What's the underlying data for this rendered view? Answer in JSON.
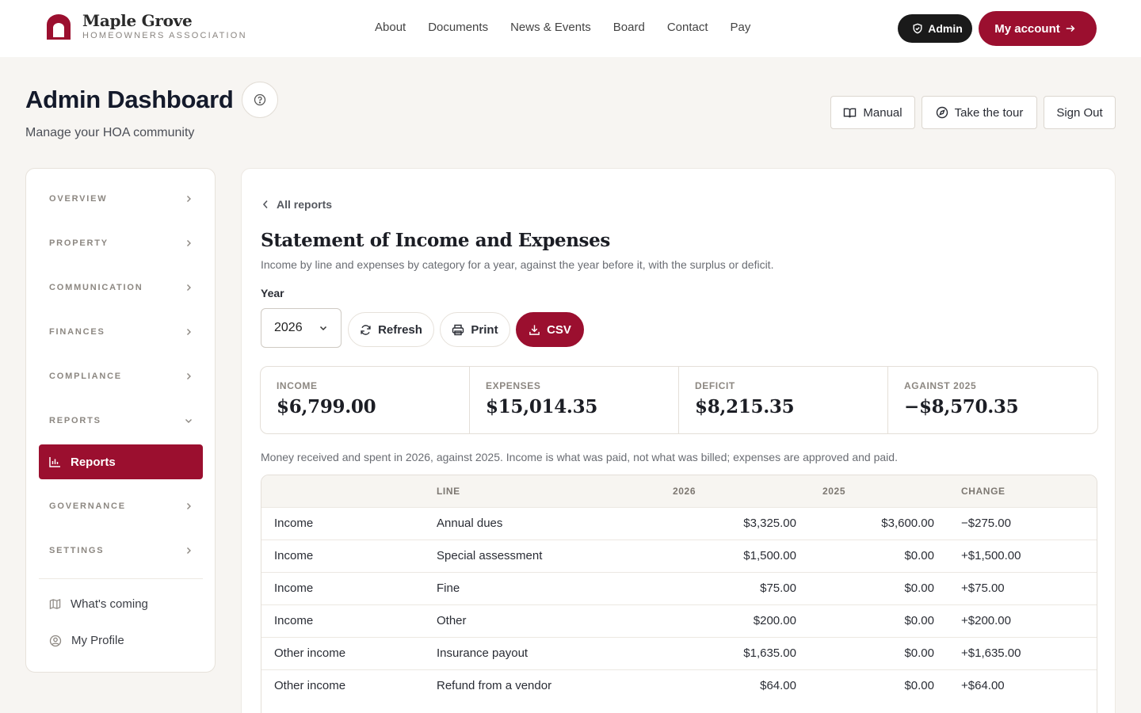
{
  "brand": {
    "name": "Maple Grove",
    "subtitle": "HOMEOWNERS ASSOCIATION"
  },
  "nav": [
    "About",
    "Documents",
    "News & Events",
    "Board",
    "Contact",
    "Pay"
  ],
  "header_actions": {
    "admin": "Admin",
    "account": "My account"
  },
  "page": {
    "title": "Admin Dashboard",
    "subtitle": "Manage your HOA community"
  },
  "page_actions": {
    "manual": "Manual",
    "tour": "Take the tour",
    "signout": "Sign Out"
  },
  "sidebar": {
    "sections": [
      "OVERVIEW",
      "PROPERTY",
      "COMMUNICATION",
      "FINANCES",
      "COMPLIANCE",
      "REPORTS",
      "GOVERNANCE",
      "SETTINGS"
    ],
    "active_item": "Reports",
    "links": [
      "What's coming",
      "My Profile"
    ]
  },
  "report": {
    "back": "All reports",
    "title": "Statement of Income and Expenses",
    "description": "Income by line and expenses by category for a year, against the year before it, with the surplus or deficit.",
    "year_label": "Year",
    "year_value": "2026",
    "buttons": {
      "refresh": "Refresh",
      "print": "Print",
      "csv": "CSV"
    },
    "stats": [
      {
        "label": "INCOME",
        "value": "$6,799.00"
      },
      {
        "label": "EXPENSES",
        "value": "$15,014.35"
      },
      {
        "label": "DEFICIT",
        "value": "$8,215.35"
      },
      {
        "label": "AGAINST 2025",
        "value": "−$8,570.35"
      }
    ],
    "note": "Money received and spent in 2026, against 2025. Income is what was paid, not what was billed; expenses are approved and paid.",
    "table": {
      "headers": [
        "",
        "LINE",
        "2026",
        "2025",
        "CHANGE"
      ],
      "rows": [
        [
          "Income",
          "Annual dues",
          "$3,325.00",
          "$3,600.00",
          "−$275.00"
        ],
        [
          "Income",
          "Special assessment",
          "$1,500.00",
          "$0.00",
          "+$1,500.00"
        ],
        [
          "Income",
          "Fine",
          "$75.00",
          "$0.00",
          "+$75.00"
        ],
        [
          "Income",
          "Other",
          "$200.00",
          "$0.00",
          "+$200.00"
        ],
        [
          "Other income",
          "Insurance payout",
          "$1,635.00",
          "$0.00",
          "+$1,635.00"
        ],
        [
          "Other income",
          "Refund from a vendor",
          "$64.00",
          "$0.00",
          "+$64.00"
        ]
      ]
    }
  },
  "colors": {
    "brand": "#9b0f2f",
    "dark": "#1a1a1a"
  }
}
